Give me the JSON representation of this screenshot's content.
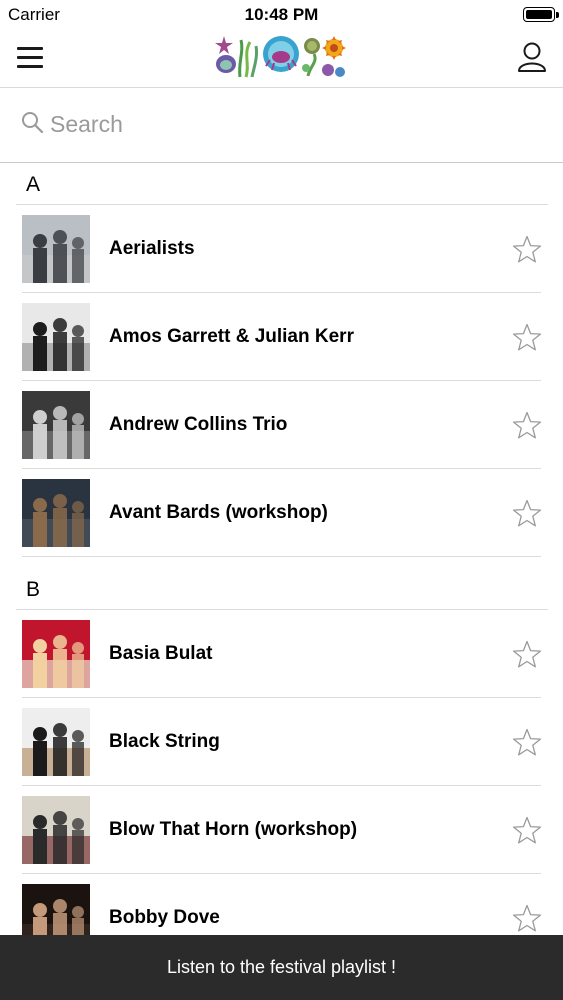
{
  "status": {
    "carrier": "Carrier",
    "time": "10:48 PM"
  },
  "nav": {
    "logo": "festival-logo-icon"
  },
  "search": {
    "placeholder": "Search"
  },
  "sections": [
    {
      "letter": "A",
      "artists": [
        {
          "name": "Aerialists",
          "thumb_colors": [
            "#b9bfc4",
            "#3a3d42",
            "#c9c9c9"
          ]
        },
        {
          "name": "Amos Garrett & Julian Kerr",
          "thumb_colors": [
            "#e8e8e8",
            "#1d1d1d",
            "#9a9a9a"
          ]
        },
        {
          "name": "Andrew Collins Trio",
          "thumb_colors": [
            "#3a3a3a",
            "#cfcfcf",
            "#7a7a7a"
          ]
        },
        {
          "name": "Avant Bards (workshop)",
          "thumb_colors": [
            "#2a3340",
            "#8a6a4a",
            "#4a5560"
          ]
        }
      ]
    },
    {
      "letter": "B",
      "artists": [
        {
          "name": "Basia Bulat",
          "thumb_colors": [
            "#c0152c",
            "#f2d0a0",
            "#e9e1d2"
          ]
        },
        {
          "name": "Black String",
          "thumb_colors": [
            "#eeeeee",
            "#1b1b1b",
            "#b89570"
          ]
        },
        {
          "name": "Blow That Horn (workshop)",
          "thumb_colors": [
            "#d9d4c9",
            "#2a2a2a",
            "#7a3a3a"
          ]
        },
        {
          "name": "Bobby Dove",
          "thumb_colors": [
            "#1a1310",
            "#c49a7a",
            "#3a2a22"
          ]
        }
      ]
    }
  ],
  "banner": {
    "label": "Listen to the festival playlist !"
  },
  "icons": {
    "menu": "hamburger-menu-icon",
    "profile": "user-profile-icon",
    "search": "search-icon",
    "favorite": "star-outline-icon"
  }
}
